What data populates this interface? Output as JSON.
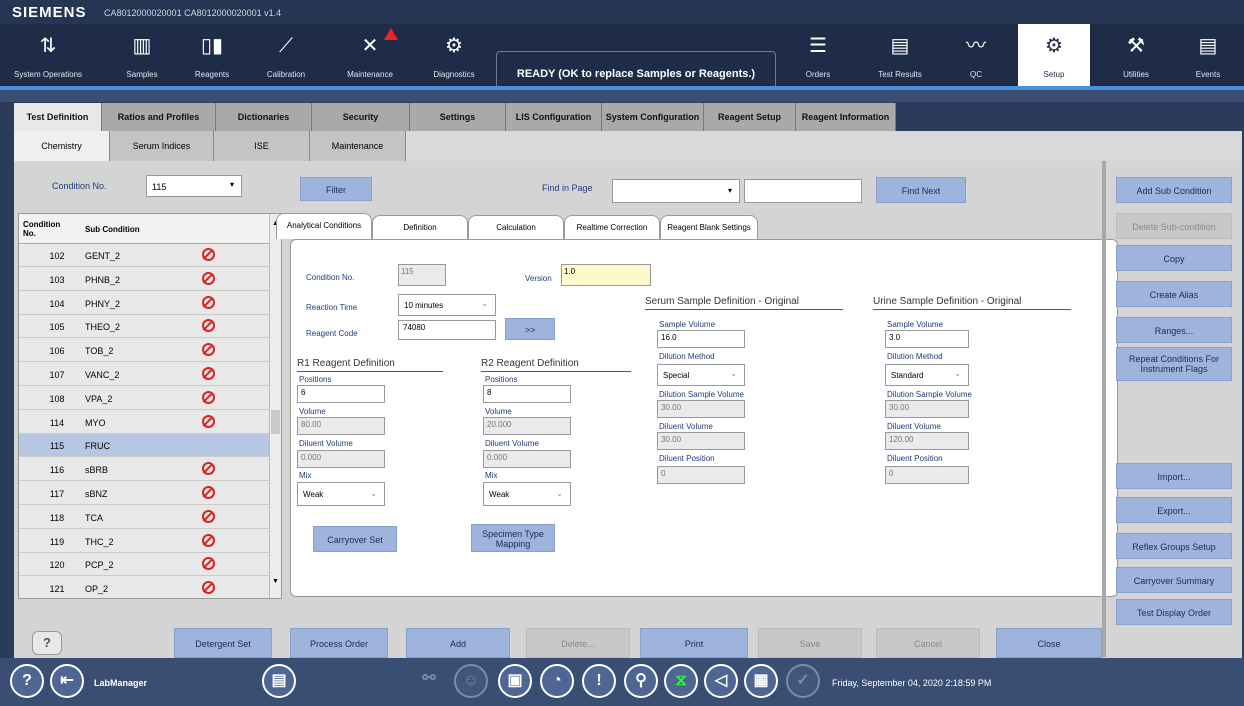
{
  "app": {
    "brand": "SIEMENS",
    "window_title": "CA8012000020001 CA8012000020001 v1.4"
  },
  "nav": [
    {
      "label": "System Operations",
      "icon": "system-operations-icon",
      "glyph": "⇅"
    },
    {
      "label": "Samples",
      "icon": "samples-icon",
      "glyph": "▥"
    },
    {
      "label": "Reagents",
      "icon": "reagents-icon",
      "glyph": "▯▮"
    },
    {
      "label": "Calibration",
      "icon": "calibration-icon",
      "glyph": "⟋"
    },
    {
      "label": "Maintenance",
      "icon": "maintenance-icon",
      "glyph": "✕"
    },
    {
      "label": "Diagnostics",
      "icon": "diagnostics-icon",
      "glyph": "⚙"
    },
    {
      "label": "Orders",
      "icon": "orders-icon",
      "glyph": "☰"
    },
    {
      "label": "Test Results",
      "icon": "test-results-icon",
      "glyph": "▤"
    },
    {
      "label": "QC",
      "icon": "qc-icon",
      "glyph": "〰"
    },
    {
      "label": "Setup",
      "icon": "setup-icon",
      "glyph": "⚙"
    },
    {
      "label": "Utilities",
      "icon": "utilities-icon",
      "glyph": "⚒"
    },
    {
      "label": "Events",
      "icon": "events-icon",
      "glyph": "▤"
    }
  ],
  "status_text": "READY (OK to replace Samples or Reagents.)",
  "tabs1": [
    "Test Definition",
    "Ratios and Profiles",
    "Dictionaries",
    "Security",
    "Settings",
    "LIS Configuration",
    "System Configuration",
    "Reagent Setup",
    "Reagent Information"
  ],
  "tabs2": [
    "Chemistry",
    "Serum Indices",
    "ISE",
    "Maintenance"
  ],
  "toolbar": {
    "condition_label": "Condition No.",
    "condition_value": "115",
    "filter": "Filter",
    "find_label": "Find in Page",
    "find_next": "Find Next"
  },
  "list": {
    "col1": "Condition No.",
    "col2": "Sub Condition",
    "rows": [
      {
        "no": "102",
        "sub": "GENT_2",
        "blocked": true
      },
      {
        "no": "103",
        "sub": "PHNB_2",
        "blocked": true
      },
      {
        "no": "104",
        "sub": "PHNY_2",
        "blocked": true
      },
      {
        "no": "105",
        "sub": "THEO_2",
        "blocked": true
      },
      {
        "no": "106",
        "sub": "TOB_2",
        "blocked": true
      },
      {
        "no": "107",
        "sub": "VANC_2",
        "blocked": true
      },
      {
        "no": "108",
        "sub": "VPA_2",
        "blocked": true
      },
      {
        "no": "114",
        "sub": "MYO",
        "blocked": true
      },
      {
        "no": "115",
        "sub": "FRUC",
        "blocked": false,
        "selected": true
      },
      {
        "no": "116",
        "sub": "sBRB",
        "blocked": true
      },
      {
        "no": "117",
        "sub": "sBNZ",
        "blocked": true
      },
      {
        "no": "118",
        "sub": "TCA",
        "blocked": true
      },
      {
        "no": "119",
        "sub": "THC_2",
        "blocked": true
      },
      {
        "no": "120",
        "sub": "PCP_2",
        "blocked": true
      },
      {
        "no": "121",
        "sub": "OP_2",
        "blocked": true
      }
    ]
  },
  "tabs3": [
    "Analytical Conditions",
    "Definition",
    "Calculation",
    "Realtime Correction",
    "Reagent Blank Settings"
  ],
  "form": {
    "condition_no_label": "Condition No.",
    "condition_no": "115",
    "version_label": "Version",
    "version": "1.0",
    "reaction_time_label": "Reaction Time",
    "reaction_time": "10 minutes",
    "reagent_code_label": "Reagent Code",
    "reagent_code": "74080",
    "go": ">>",
    "r1_title": "R1 Reagent Definition",
    "r2_title": "R2 Reagent Definition",
    "positions_label": "Positions",
    "volume_label": "Volume",
    "diluent_volume_label": "Diluent Volume",
    "mix_label": "Mix",
    "r1_positions": "6",
    "r1_volume": "80.00",
    "r1_diluent": "0.000",
    "r1_mix": "Weak",
    "r2_positions": "8",
    "r2_volume": "20.000",
    "r2_diluent": "0.000",
    "r2_mix": "Weak",
    "carryover_set": "Carryover Set",
    "specimen_mapping": "Specimen Type Mapping",
    "serum_title": "Serum Sample Definition - Original",
    "urine_title": "Urine Sample Definition - Original",
    "sample_volume_label": "Sample Volume",
    "dilution_method_label": "Dilution Method",
    "dilution_sample_volume_label": "Dilution Sample Volume",
    "diluent_position_label": "Diluent Position",
    "serum_sample_volume": "16.0",
    "serum_dilution_method": "Special",
    "serum_dilution_sample_volume": "30.00",
    "serum_diluent_volume": "30.00",
    "serum_diluent_position": "0",
    "urine_sample_volume": "3.0",
    "urine_dilution_method": "Standard",
    "urine_dilution_sample_volume": "30.00",
    "urine_diluent_volume": "120.00",
    "urine_diluent_position": "0"
  },
  "right_buttons": [
    {
      "label": "Add Sub Condition",
      "enabled": true
    },
    {
      "label": "Delete Sub-condition",
      "enabled": false
    },
    {
      "label": "Copy",
      "enabled": true
    },
    {
      "label": "Create Alias",
      "enabled": true
    },
    {
      "label": "Ranges...",
      "enabled": true
    },
    {
      "label": "Repeat Conditions For Instrument Flags",
      "enabled": true
    },
    {
      "label": "Import...",
      "enabled": true
    },
    {
      "label": "Export...",
      "enabled": true
    },
    {
      "label": "Reflex Groups Setup",
      "enabled": true
    },
    {
      "label": "Carryover Summary",
      "enabled": true
    },
    {
      "label": "Test Display Order",
      "enabled": true
    }
  ],
  "bottom_buttons": [
    {
      "label": "Detergent Set",
      "enabled": true
    },
    {
      "label": "Process Order",
      "enabled": true
    },
    {
      "label": "Add",
      "enabled": true
    },
    {
      "label": "Delete...",
      "enabled": false
    },
    {
      "label": "Print",
      "enabled": true
    },
    {
      "label": "Save",
      "enabled": false
    },
    {
      "label": "Cancel",
      "enabled": false
    },
    {
      "label": "Close",
      "enabled": true
    }
  ],
  "help": "?",
  "taskbar": {
    "user": "LabManager",
    "datetime": "Friday, September 04, 2020 2:18:59 PM"
  }
}
